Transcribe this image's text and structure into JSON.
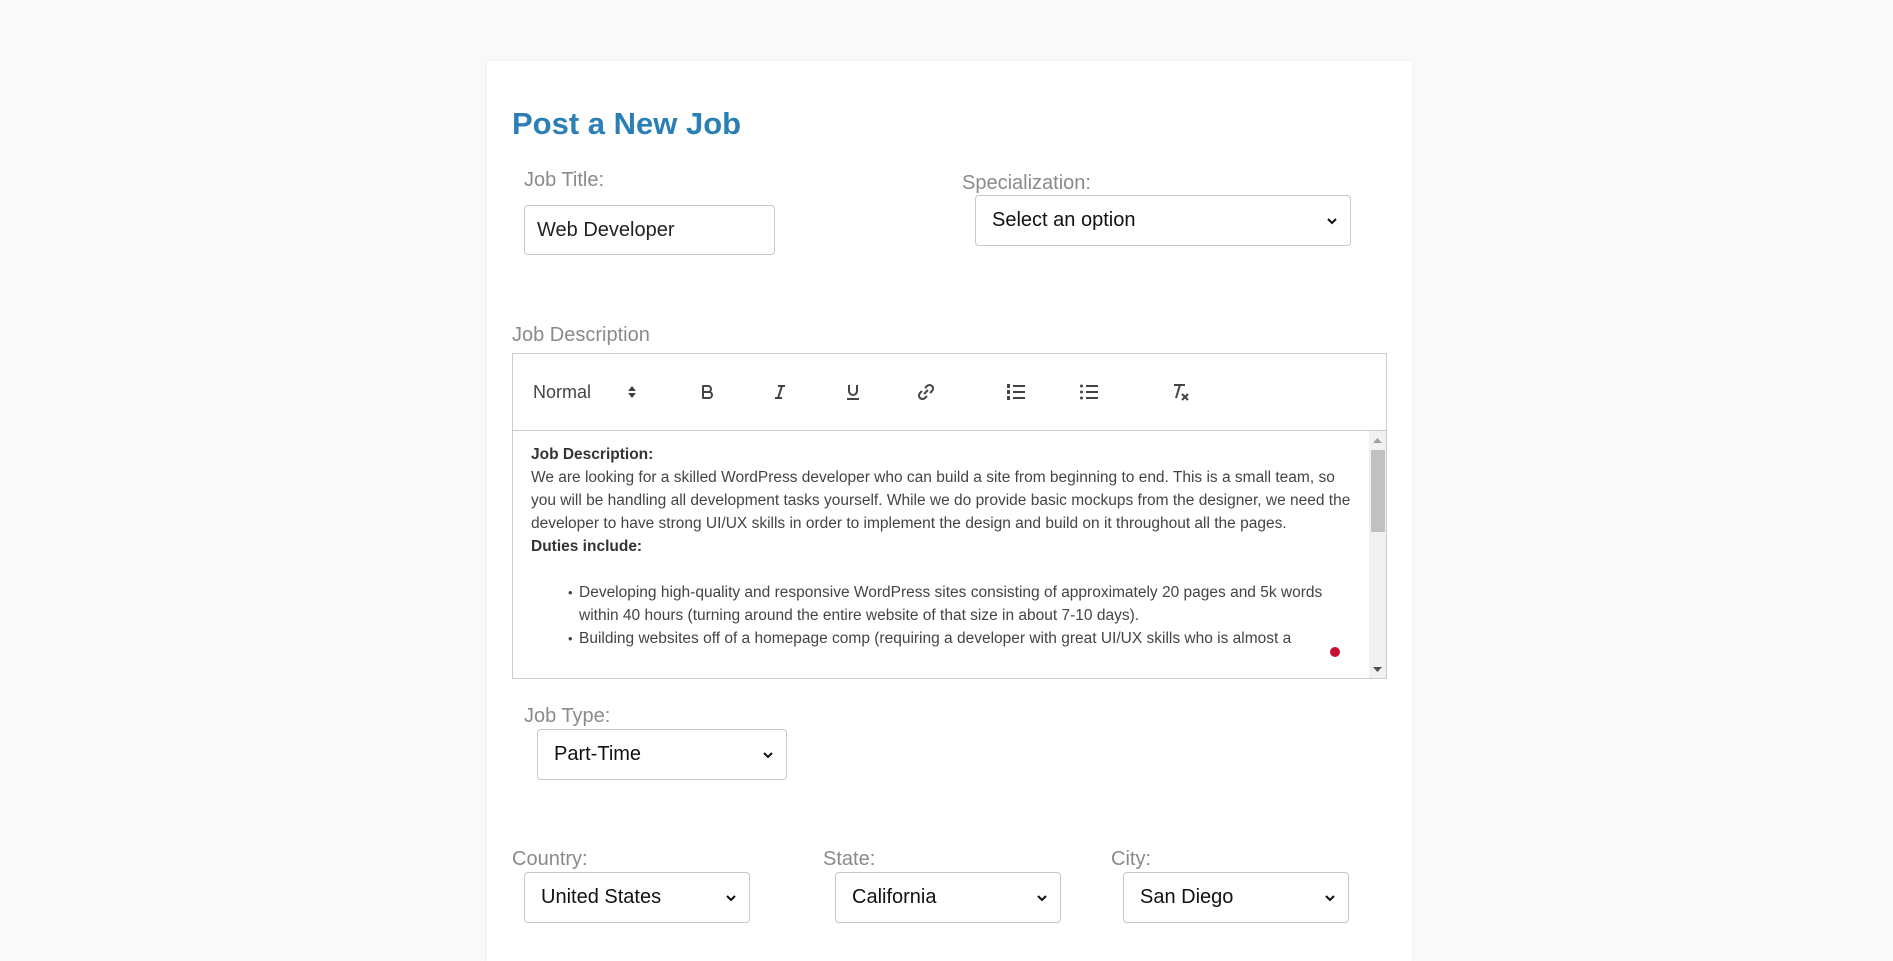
{
  "page": {
    "title": "Post a New Job"
  },
  "job_title": {
    "label": "Job Title:",
    "value": "Web Developer"
  },
  "specialization": {
    "label": "Specialization:",
    "selected": "Select an option"
  },
  "job_description": {
    "label": "Job Description",
    "toolbar": {
      "header_select": "Normal",
      "buttons": [
        "bold-icon",
        "italic-icon",
        "underline-icon",
        "link-icon",
        "ordered-list-icon",
        "bullet-list-icon",
        "clear-format-icon"
      ]
    },
    "content": {
      "heading": "Job Description:",
      "paragraph": "We are looking for a skilled WordPress developer who can build a site from beginning to end. This is a small team, so you will be handling all development tasks yourself. While we do provide basic mockups from the designer, we need the developer to have strong UI/UX skills in order to implement the design and build on it throughout all the pages.",
      "duties_heading": "Duties include:",
      "duties": [
        "Developing high-quality and responsive WordPress sites consisting of approximately 20 pages and 5k words within 40 hours (turning around the entire website of that size in about 7-10 days).",
        "Building websites off of a homepage comp (requiring a developer with great UI/UX skills who is almost a"
      ]
    }
  },
  "job_type": {
    "label": "Job Type:",
    "selected": "Part-Time"
  },
  "location": {
    "country": {
      "label": "Country:",
      "selected": "United States"
    },
    "state": {
      "label": "State:",
      "selected": "California"
    },
    "city": {
      "label": "City:",
      "selected": "San Diego"
    }
  },
  "colors": {
    "title": "#2a7fb5",
    "label": "#8a8a8a",
    "indicator_dot": "#c8102e"
  }
}
